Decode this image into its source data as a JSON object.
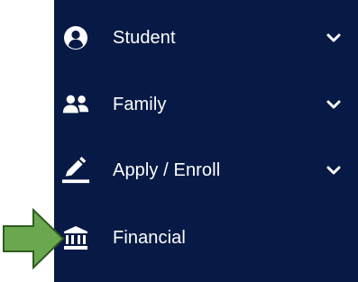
{
  "nav": {
    "items": [
      {
        "label": "Student",
        "icon": "user-circle-icon",
        "has_submenu": true
      },
      {
        "label": "Family",
        "icon": "users-icon",
        "has_submenu": true
      },
      {
        "label": "Apply / Enroll",
        "icon": "pen-icon",
        "has_submenu": true
      },
      {
        "label": "Financial",
        "icon": "bank-icon",
        "has_submenu": false
      }
    ]
  },
  "colors": {
    "sidebar_bg": "#071a45",
    "text": "#ffffff",
    "arrow_fill": "#6aa84f",
    "arrow_stroke": "#2f5b1f"
  },
  "annotation": {
    "icon": "green-arrow-icon",
    "points_to": "Financial"
  }
}
